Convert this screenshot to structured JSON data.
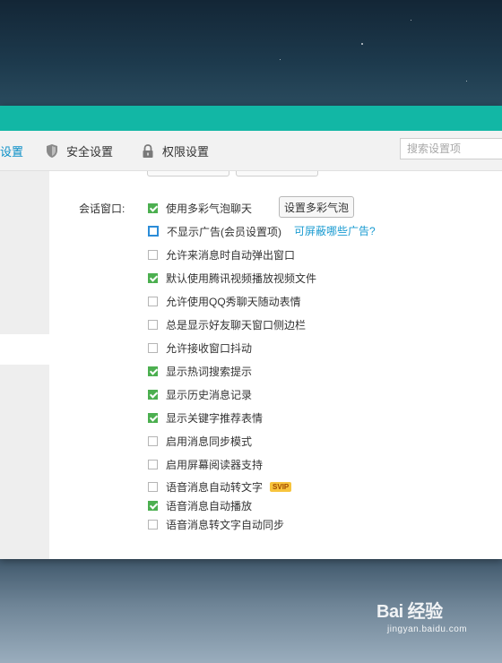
{
  "toolbar": {
    "partial_tab_label": "设置",
    "security_tab_label": "安全设置",
    "permission_tab_label": "权限设置",
    "search_placeholder": "搜索设置项"
  },
  "section": {
    "label": "会话窗口:"
  },
  "options": [
    {
      "label": "使用多彩气泡聊天",
      "checked": true
    },
    {
      "label": "不显示广告(会员设置项)",
      "checked": false
    },
    {
      "label": "允许来消息时自动弹出窗口",
      "checked": false
    },
    {
      "label": "默认使用腾讯视频播放视频文件",
      "checked": true
    },
    {
      "label": "允许使用QQ秀聊天随动表情",
      "checked": false
    },
    {
      "label": "总是显示好友聊天窗口侧边栏",
      "checked": false
    },
    {
      "label": "允许接收窗口抖动",
      "checked": false
    },
    {
      "label": "显示热词搜索提示",
      "checked": true
    },
    {
      "label": "显示历史消息记录",
      "checked": true
    },
    {
      "label": "显示关键字推荐表情",
      "checked": true
    },
    {
      "label": "启用消息同步模式",
      "checked": false
    },
    {
      "label": "启用屏幕阅读器支持",
      "checked": false
    },
    {
      "label": "语音消息自动转文字",
      "checked": false
    },
    {
      "label": "语音消息自动播放",
      "checked": true
    },
    {
      "label": "语音消息转文字自动同步",
      "checked": false
    }
  ],
  "buttons": {
    "set_bubble": "设置多彩气泡"
  },
  "links": {
    "ad_info": "可屏蔽哪些广告?"
  },
  "badges": {
    "svip": "SVIP"
  },
  "watermark": {
    "logo": "Bai 经验",
    "url": "jingyan.baidu.com"
  },
  "colors": {
    "titlebar": "#12b7a5",
    "checked": "#4caf50",
    "link": "#1a9bd1"
  }
}
